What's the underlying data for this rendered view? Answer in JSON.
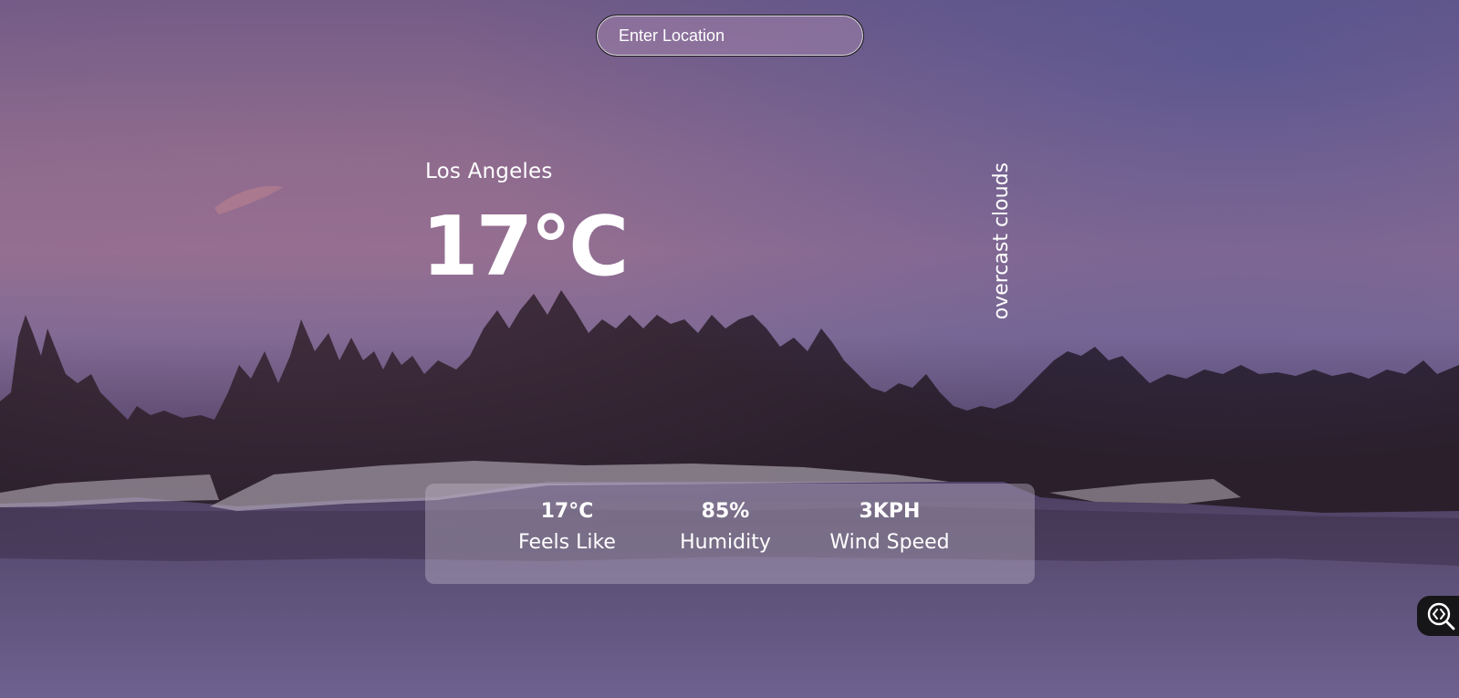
{
  "search": {
    "placeholder": "Enter Location",
    "value": ""
  },
  "weather": {
    "city": "Los Angeles",
    "temperature": "17°C",
    "description": "overcast clouds"
  },
  "stats": {
    "feels_like": {
      "value": "17°C",
      "label": "Feels Like"
    },
    "humidity": {
      "value": "85%",
      "label": "Humidity"
    },
    "wind_speed": {
      "value": "3KPH",
      "label": "Wind Speed"
    }
  },
  "widget": {
    "icon": "code-search-icon"
  },
  "colors": {
    "text": "#ffffff",
    "panel": "rgba(190,180,200,0.42)",
    "widget": "#161618"
  }
}
